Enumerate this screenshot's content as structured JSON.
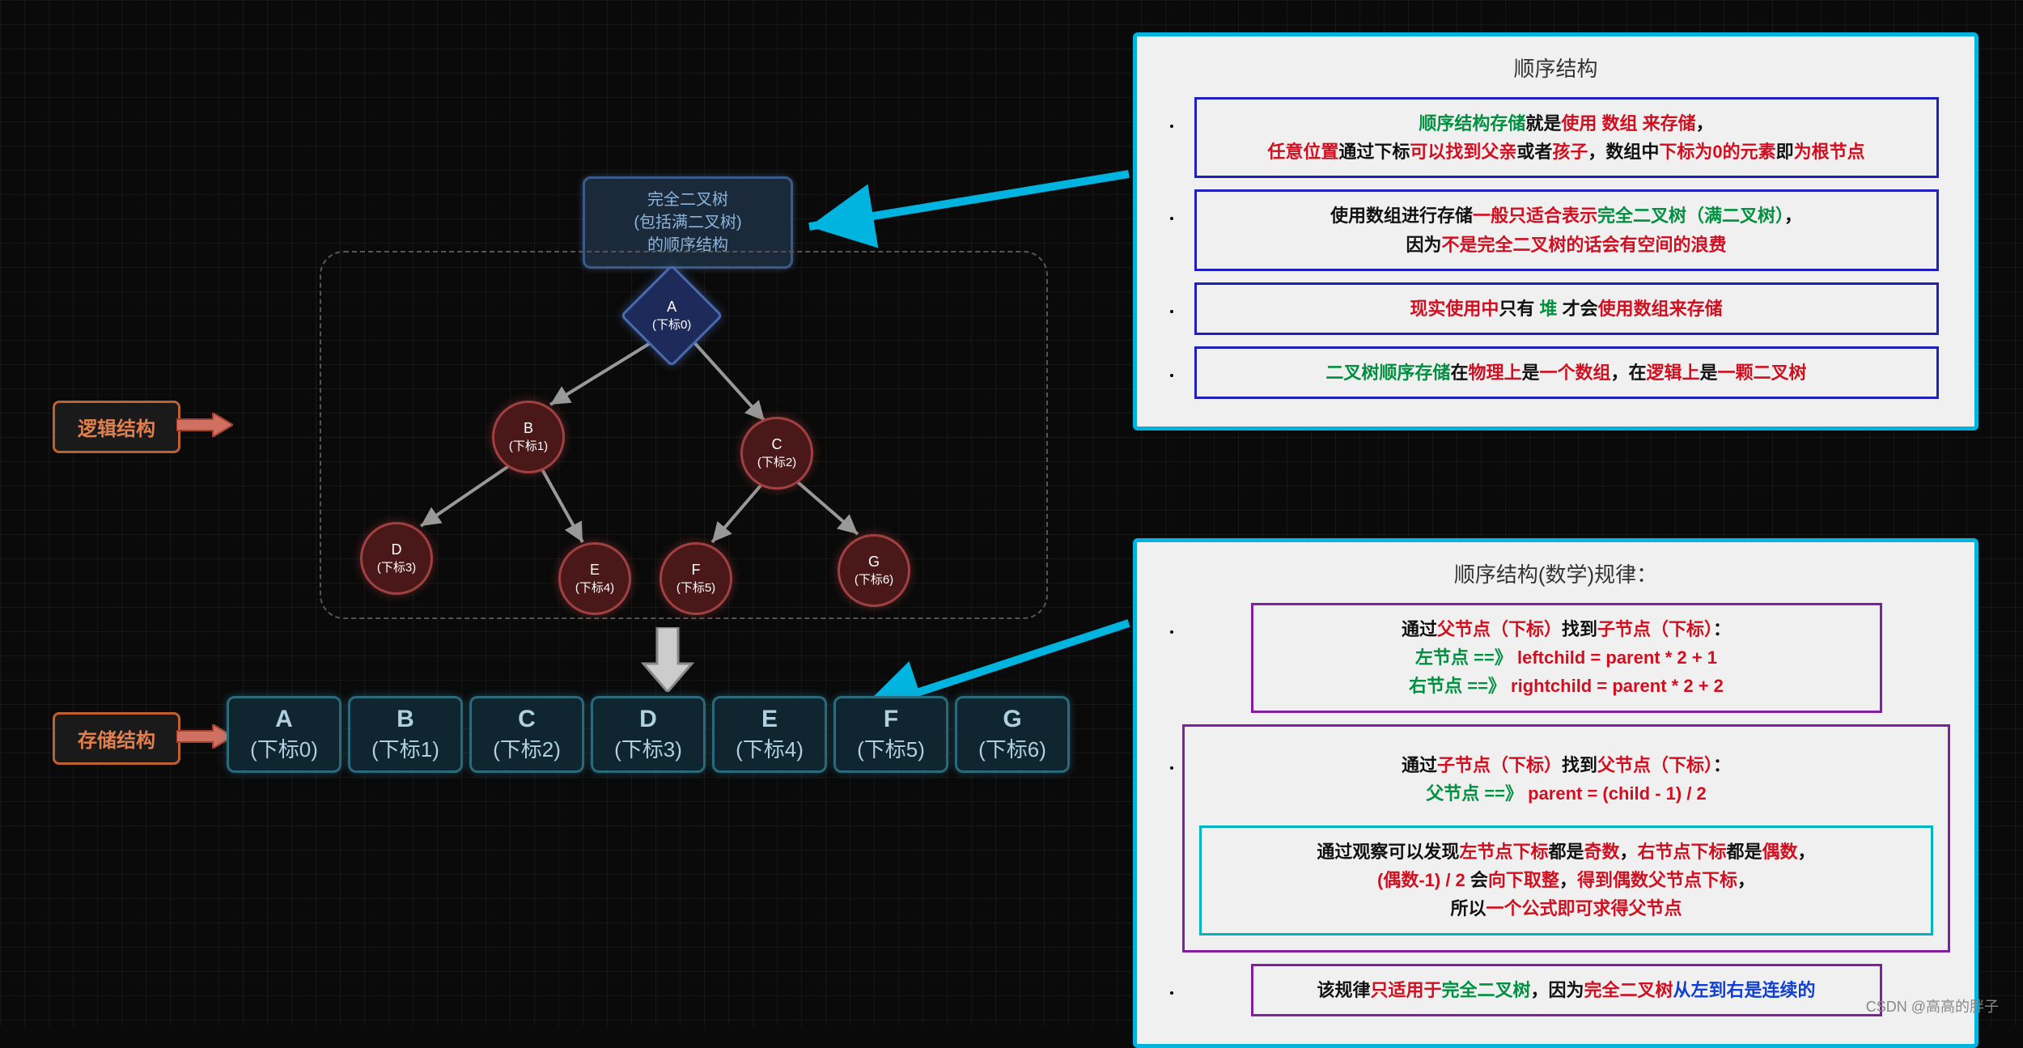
{
  "header": "完全二叉树\n(包括满二叉树)\n的顺序结构",
  "labels": {
    "logic": "逻辑结构",
    "store": "存储结构"
  },
  "nodes": {
    "A": {
      "name": "A",
      "sub": "(下标0)"
    },
    "B": {
      "name": "B",
      "sub": "(下标1)"
    },
    "C": {
      "name": "C",
      "sub": "(下标2)"
    },
    "D": {
      "name": "D",
      "sub": "(下标3)"
    },
    "E": {
      "name": "E",
      "sub": "(下标4)"
    },
    "F": {
      "name": "F",
      "sub": "(下标5)"
    },
    "G": {
      "name": "G",
      "sub": "(下标6)"
    }
  },
  "array": [
    {
      "v": "A",
      "s": "(下标0)"
    },
    {
      "v": "B",
      "s": "(下标1)"
    },
    {
      "v": "C",
      "s": "(下标2)"
    },
    {
      "v": "D",
      "s": "(下标3)"
    },
    {
      "v": "E",
      "s": "(下标4)"
    },
    {
      "v": "F",
      "s": "(下标5)"
    },
    {
      "v": "G",
      "s": "(下标6)"
    }
  ],
  "panel1": {
    "title": "顺序结构",
    "items": [
      {
        "border": "b-blue",
        "html": [
          [
            "green",
            "顺序结构存储"
          ],
          [
            "black",
            "就是"
          ],
          [
            "red",
            "使用 "
          ],
          [
            "red",
            "数组"
          ],
          [
            "red",
            " 来存储"
          ],
          [
            "black",
            "，"
          ],
          [
            "br",
            ""
          ],
          [
            "red",
            "任意位置"
          ],
          [
            "black",
            "通过下标"
          ],
          [
            "red",
            "可以找到父亲"
          ],
          [
            "black",
            "或者"
          ],
          [
            "red",
            "孩子"
          ],
          [
            "black",
            "，数组中"
          ],
          [
            "red",
            "下标为0的元素"
          ],
          [
            "black",
            "即"
          ],
          [
            "red",
            "为根节点"
          ]
        ]
      },
      {
        "border": "b-blue",
        "html": [
          [
            "black",
            "使用数组进行存储"
          ],
          [
            "red",
            "一般只适合表示"
          ],
          [
            "green",
            "完全二叉树（满二叉树）"
          ],
          [
            "black",
            "，"
          ],
          [
            "br",
            ""
          ],
          [
            "black",
            "因为"
          ],
          [
            "red",
            "不是完全二叉树的话会有空间的浪费"
          ]
        ]
      },
      {
        "border": "b-blue",
        "html": [
          [
            "red",
            "现实使用中"
          ],
          [
            "black",
            "只有 "
          ],
          [
            "green",
            "堆 "
          ],
          [
            "black",
            "才会"
          ],
          [
            "red",
            "使用数组来存储"
          ]
        ]
      },
      {
        "border": "b-blue",
        "html": [
          [
            "green",
            "二叉树顺序存储"
          ],
          [
            "black",
            "在"
          ],
          [
            "red",
            "物理上"
          ],
          [
            "black",
            "是"
          ],
          [
            "red",
            "一个数组"
          ],
          [
            "black",
            "，在"
          ],
          [
            "red",
            "逻辑上"
          ],
          [
            "black",
            "是"
          ],
          [
            "red",
            "一颗二叉树"
          ]
        ]
      }
    ]
  },
  "panel2": {
    "title": "顺序结构(数学)规律：",
    "parentToChild": [
      [
        "black",
        "通过"
      ],
      [
        "red",
        "父节点（下标）"
      ],
      [
        "black",
        "找到"
      ],
      [
        "red",
        "子节点（下标）"
      ],
      [
        "black",
        "："
      ],
      [
        "br",
        ""
      ],
      [
        "green",
        "左节点  ==》"
      ],
      [
        "red",
        "   leftchild  =  parent * 2 + 1"
      ],
      [
        "br",
        ""
      ],
      [
        "green",
        "右节点  ==》"
      ],
      [
        "red",
        "    rightchild  =  parent * 2 + 2"
      ]
    ],
    "childToParent": [
      [
        "black",
        "通过"
      ],
      [
        "red",
        "子节点（下标）"
      ],
      [
        "black",
        "找到"
      ],
      [
        "red",
        "父节点（下标）"
      ],
      [
        "black",
        "："
      ],
      [
        "br",
        ""
      ],
      [
        "green",
        "父节点  ==》"
      ],
      [
        "red",
        "  parent  = (child - 1) / 2"
      ]
    ],
    "observation": [
      [
        "black",
        "通过观察可以发现"
      ],
      [
        "red",
        "左节点下标"
      ],
      [
        "black",
        "都是"
      ],
      [
        "red",
        "奇数"
      ],
      [
        "black",
        "，"
      ],
      [
        "red",
        "右节点下标"
      ],
      [
        "black",
        "都是"
      ],
      [
        "red",
        "偶数"
      ],
      [
        "black",
        "，"
      ],
      [
        "br",
        ""
      ],
      [
        "red",
        "(偶数-1) / 2 "
      ],
      [
        "black",
        "会"
      ],
      [
        "red",
        "向下取整"
      ],
      [
        "black",
        "，"
      ],
      [
        "red",
        "得到偶数父节点下标"
      ],
      [
        "black",
        "，"
      ],
      [
        "br",
        ""
      ],
      [
        "black",
        "所以"
      ],
      [
        "red",
        "一个公式即可求得父节点"
      ]
    ],
    "rule": [
      [
        "black",
        "该规律"
      ],
      [
        "red",
        "只适用于"
      ],
      [
        "green",
        "完全二叉树"
      ],
      [
        "black",
        "，因为"
      ],
      [
        "red",
        "完全二叉树"
      ],
      [
        "blue",
        "从左到右是连续的"
      ]
    ]
  },
  "watermark": "CSDN @高高的胖子"
}
